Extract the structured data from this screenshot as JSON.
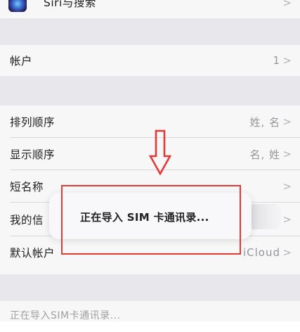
{
  "settings": {
    "siri_row": {
      "label": "Siri与搜索",
      "chevron": ">"
    },
    "accounts_row": {
      "label": "帐户",
      "value": "1",
      "chevron": ">"
    },
    "sort_order_row": {
      "label": "排列顺序",
      "value": "姓, 名",
      "chevron": ">"
    },
    "display_order_row": {
      "label": "显示顺序",
      "value": "名, 姓",
      "chevron": ">"
    },
    "short_name_row": {
      "label": "短名称",
      "chevron": ">"
    },
    "my_info_row": {
      "label": "我的信",
      "chevron": ">"
    },
    "default_account_row": {
      "label": "默认帐户",
      "value": "iCloud",
      "chevron": ">"
    },
    "import_sim_row": {
      "label": "正在导入SIM卡通讯录..."
    }
  },
  "toast": {
    "text": "正在导入 SIM 卡通讯录..."
  },
  "annotations": {
    "arrow_color": "#e53935",
    "box_color": "#e53935"
  }
}
